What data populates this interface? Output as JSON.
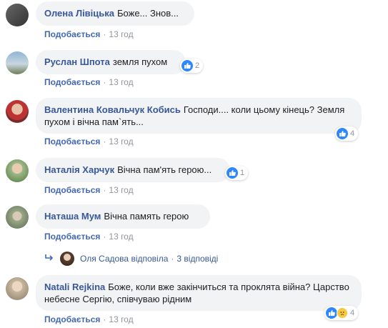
{
  "colors": {
    "link": "#385898",
    "meta": "#90949c",
    "like_blue": "#2d88ff",
    "bubble": "#f2f3f5"
  },
  "comments": [
    {
      "author": "Олена Лівіцька",
      "text": "Боже... Знов...",
      "like_label": "Подобається",
      "time": "13 год",
      "reactions": null
    },
    {
      "author": "Руслан Шпота",
      "text": "земля пухом",
      "like_label": "Подобається",
      "time": "13 год",
      "reactions": {
        "count": "2",
        "icons": [
          "like-icon"
        ]
      }
    },
    {
      "author": "Валентина Ковальчук Кобись",
      "text": "Господи.... коли цьому кінець? Земля пухом і вічна пам`ять...",
      "like_label": "Подобається",
      "time": "13 год",
      "reactions": {
        "count": "4",
        "icons": [
          "like-icon"
        ]
      }
    },
    {
      "author": "Наталія Харчук",
      "text": "Вічна пам'ять герою...",
      "like_label": "Подобається",
      "time": "13 год",
      "reactions": {
        "count": "1",
        "icons": [
          "like-icon"
        ]
      }
    },
    {
      "author": "Наташа Мум",
      "text": "Вічна память герою",
      "like_label": "Подобається",
      "time": "13 год",
      "reactions": null
    },
    {
      "author": "Natali Rejkina",
      "text": "Боже, коли вже закінчиться та проклята війна? Царство небесне Сергію, співчуваю рідним",
      "like_label": "Подобається",
      "time": "13 год",
      "reactions": {
        "count": "4",
        "icons": [
          "like-icon",
          "sad-icon"
        ]
      }
    }
  ],
  "reply_summary": {
    "replier": "Оля Садова",
    "action": "відповіла",
    "count_text": "3 відповіді"
  }
}
